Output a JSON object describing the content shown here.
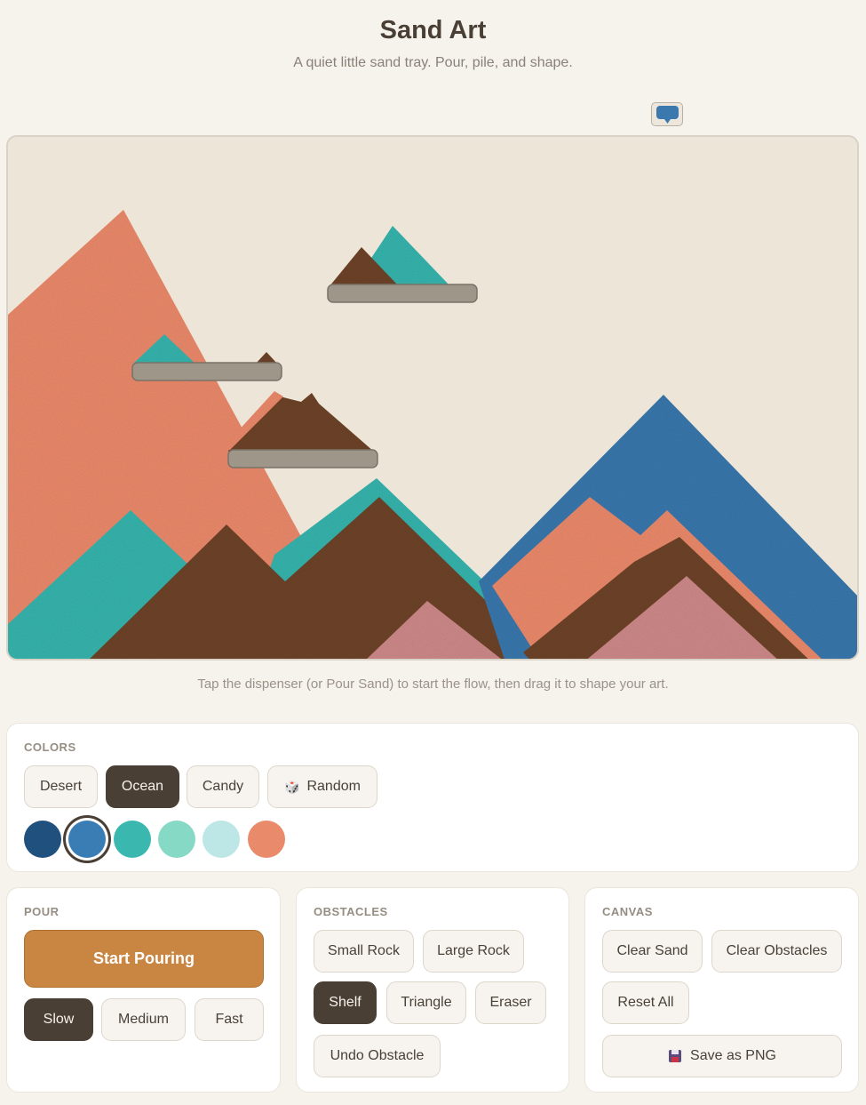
{
  "app": {
    "title": "Sand Art",
    "subtitle": "A quiet little sand tray. Pour, pile, and shape."
  },
  "dispenser": {
    "icon": "speech-bubble-icon",
    "color": "#3b78ad"
  },
  "canvas": {
    "background": "#ede5d8",
    "hint": "Tap the dispenser (or Pour Sand) to start the flow, then drag it to shape your art."
  },
  "colors": {
    "label": "COLORS",
    "palettes": [
      {
        "label": "Desert",
        "active": false
      },
      {
        "label": "Ocean",
        "active": true
      },
      {
        "label": "Candy",
        "active": false
      },
      {
        "label": "Random",
        "active": false,
        "icon": "dice-icon"
      }
    ],
    "swatches": [
      {
        "color": "#1f507e",
        "selected": false
      },
      {
        "color": "#3a7db5",
        "selected": true
      },
      {
        "color": "#3ab8b0",
        "selected": false
      },
      {
        "color": "#86d9c4",
        "selected": false
      },
      {
        "color": "#bde7e6",
        "selected": false
      },
      {
        "color": "#e98a6a",
        "selected": false
      }
    ]
  },
  "pour": {
    "label": "POUR",
    "start_label": "Start Pouring",
    "speeds": [
      {
        "label": "Slow",
        "active": true
      },
      {
        "label": "Medium",
        "active": false
      },
      {
        "label": "Fast",
        "active": false
      }
    ]
  },
  "obstacles": {
    "label": "OBSTACLES",
    "tools": [
      {
        "label": "Small Rock",
        "active": false
      },
      {
        "label": "Large Rock",
        "active": false
      },
      {
        "label": "Shelf",
        "active": true
      },
      {
        "label": "Triangle",
        "active": false
      },
      {
        "label": "Eraser",
        "active": false
      },
      {
        "label": "Undo Obstacle",
        "active": false
      }
    ]
  },
  "canvas_controls": {
    "label": "CANVAS",
    "clear_sand": "Clear Sand",
    "clear_obstacles": "Clear Obstacles",
    "reset_all": "Reset All",
    "save_png": "Save as PNG",
    "save_icon": "floppy-disk-icon"
  },
  "sand_colors": {
    "salmon": "#ec8a6c",
    "teal": "#39b5ae",
    "brown": "#6e4529",
    "blue": "#3b78ad",
    "pink": "#cf8a8a",
    "shelf": "#9f968a"
  }
}
